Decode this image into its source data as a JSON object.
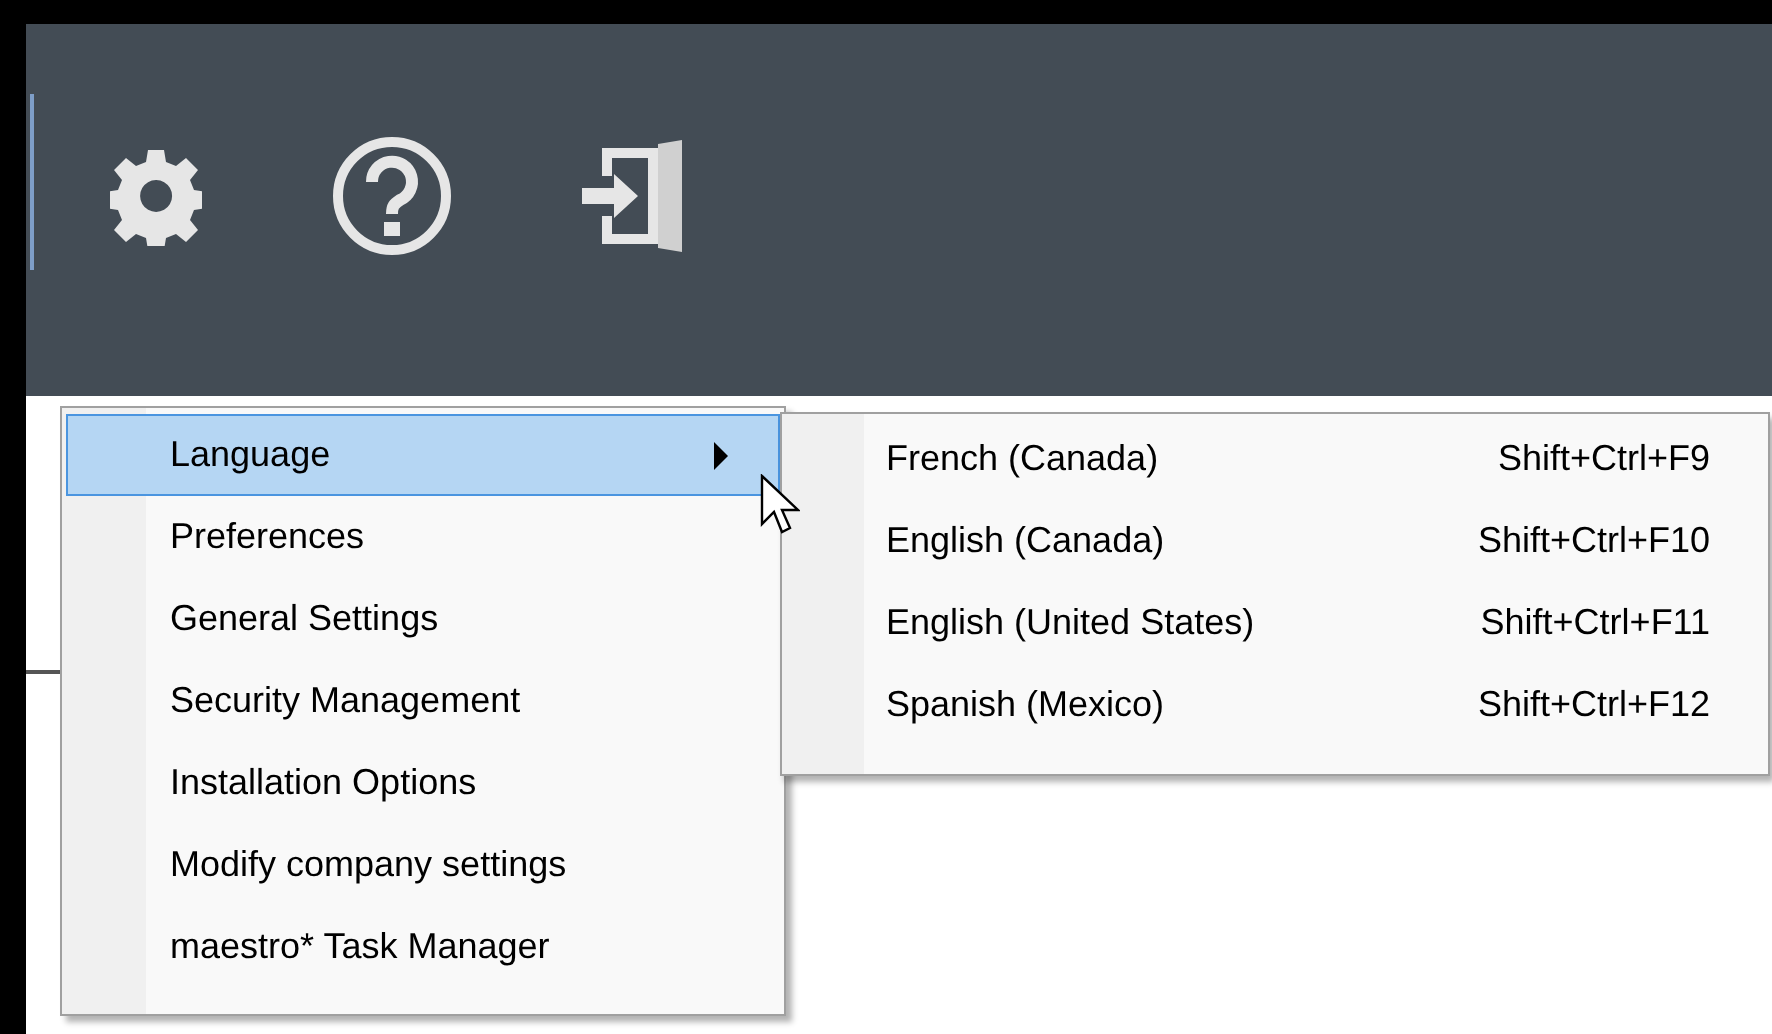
{
  "toolbar": {
    "buttons": [
      {
        "kind": "settings"
      },
      {
        "kind": "help"
      },
      {
        "kind": "exit"
      }
    ]
  },
  "menu": {
    "items": [
      {
        "label": "Language",
        "selected": true,
        "submenu": true
      },
      {
        "label": "Preferences",
        "selected": false,
        "submenu": false
      },
      {
        "label": "General Settings",
        "selected": false,
        "submenu": false
      },
      {
        "label": "Security Management",
        "selected": false,
        "submenu": false
      },
      {
        "label": "Installation Options",
        "selected": false,
        "submenu": false
      },
      {
        "label": "Modify company settings",
        "selected": false,
        "submenu": false
      },
      {
        "label": "maestro* Task Manager",
        "selected": false,
        "submenu": false
      }
    ]
  },
  "submenu": {
    "items": [
      {
        "label": "French (Canada)",
        "shortcut": "Shift+Ctrl+F9"
      },
      {
        "label": "English (Canada)",
        "shortcut": "Shift+Ctrl+F10"
      },
      {
        "label": "English (United States)",
        "shortcut": "Shift+Ctrl+F11"
      },
      {
        "label": "Spanish (Mexico)",
        "shortcut": "Shift+Ctrl+F12"
      }
    ]
  }
}
